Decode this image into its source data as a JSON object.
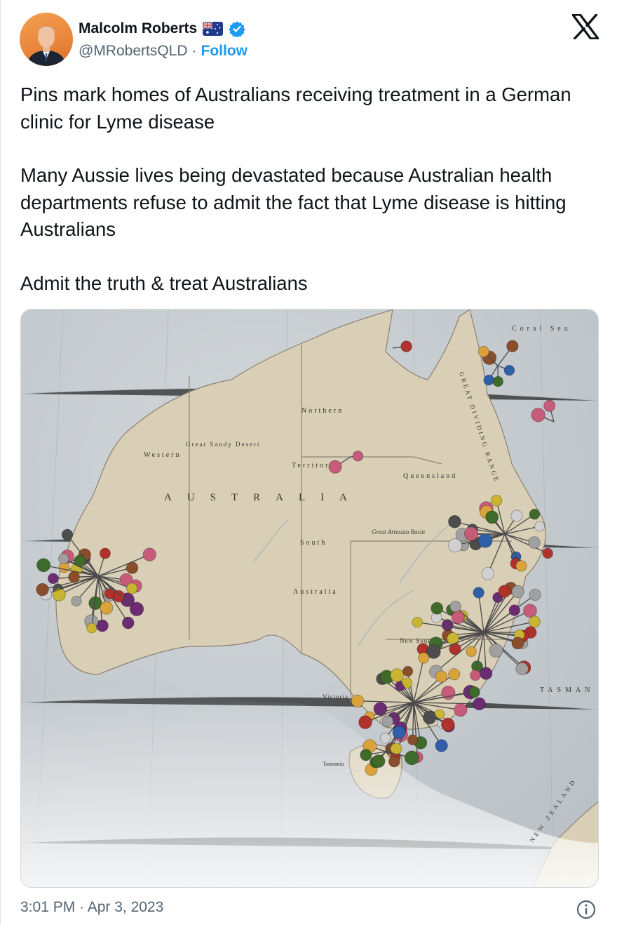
{
  "author": {
    "name": "Malcolm Roberts",
    "handle": "@MRobertsQLD",
    "separator": "·",
    "follow_label": "Follow",
    "avatar_icon": "avatar-photo",
    "flag_icon": "australia-flag-icon",
    "verified_icon": "verified-badge-icon"
  },
  "platform_icon": "x-logo-icon",
  "tweet": {
    "paragraphs": [
      "Pins mark homes of Australians receiving treatment in a German clinic for Lyme disease",
      "Many Aussie lives being devastated because Australian health departments refuse to admit the fact that Lyme disease is hitting Australians",
      "Admit the truth & treat Australians"
    ]
  },
  "map_labels": {
    "country": [
      "A",
      "U",
      "S",
      "T",
      "R",
      "A",
      "L",
      "I",
      "A"
    ],
    "northern": "Northern",
    "territory": "Territory",
    "western": "Western",
    "great_sandy": "Great Sandy Desert",
    "south": "South",
    "australia": "Australia",
    "queensland": "Queensland",
    "great_artesian": "Great Artesian Basin",
    "new_south_wales": "New South Wales",
    "victoria": "Victoria",
    "tasmania": "Tasmania",
    "coral_sea": "Coral Sea",
    "tasman_sea": "TASMAN SEA",
    "great_dividing": "GREAT DIVIDING RANGE",
    "new_zealand": "NEW ZEALAND"
  },
  "colors": {
    "link": "#1d9bf0",
    "secondary_text": "#536471",
    "map_land": "#d8cdb4",
    "map_sea": "#c9ced3"
  },
  "footer": {
    "timestamp": "3:01 PM · Apr 3, 2023",
    "info_icon": "info-icon"
  }
}
